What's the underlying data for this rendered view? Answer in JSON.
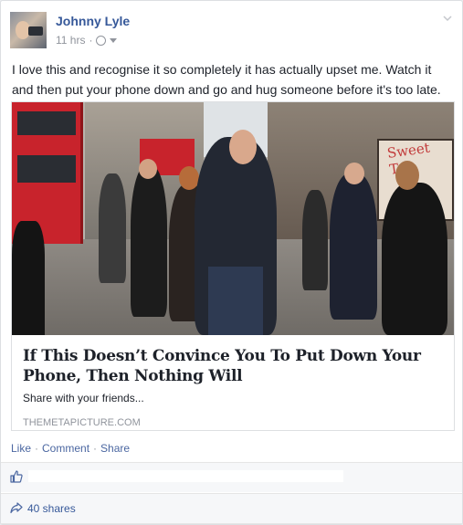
{
  "post": {
    "author": "Johnny Lyle",
    "time": "11 hrs",
    "separator": "·",
    "privacy_icon": "globe-icon",
    "text": "I love this and recognise it so completely it has actually upset me. Watch it and then put your phone down and go and hug someone before it's too late."
  },
  "link_card": {
    "image_signage": "Sweet Tou",
    "title": "If This Doesn’t Convince You To Put Down Your Phone, Then Nothing Will",
    "description": "Share with your friends...",
    "domain": "THEMETAPICTURE.COM"
  },
  "actions": {
    "like": "Like",
    "comment": "Comment",
    "share": "Share",
    "sep": "·"
  },
  "stats": {
    "like_icon": "thumbs-up-icon",
    "share_icon": "share-arrow-icon",
    "shares": "40 shares"
  },
  "colors": {
    "link": "#365899",
    "action": "#4b67a1",
    "muted": "#90949c"
  }
}
